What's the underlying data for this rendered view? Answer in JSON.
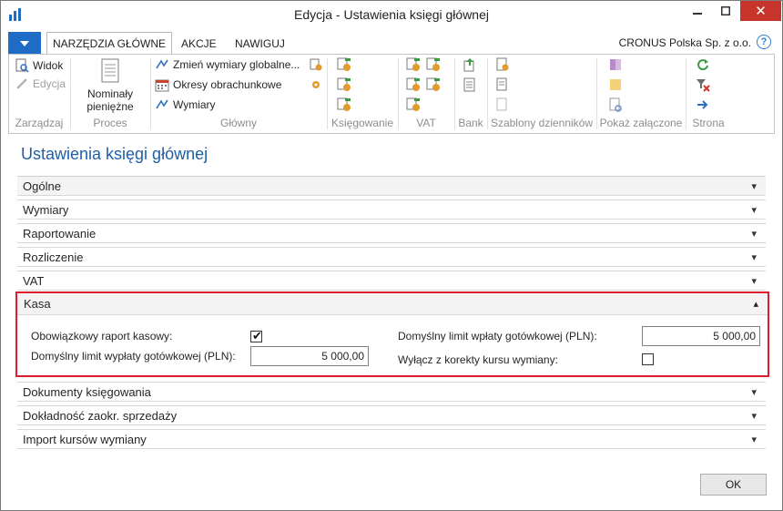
{
  "window": {
    "title": "Edycja - Ustawienia księgi głównej",
    "minimize_icon": "minimize-icon",
    "maximize_icon": "maximize-icon",
    "close_icon": "close-icon"
  },
  "menu": {
    "tabs": [
      {
        "label": "NARZĘDZIA GŁÓWNE",
        "active": true
      },
      {
        "label": "AKCJE",
        "active": false
      },
      {
        "label": "NAWIGUJ",
        "active": false
      }
    ],
    "company": "CRONUS Polska Sp. z o.o.",
    "help_glyph": "?"
  },
  "ribbon": {
    "groups": {
      "zarzadzaj": {
        "label": "Zarządzaj",
        "items": [
          {
            "label": "Widok",
            "icon": "view-icon",
            "disabled": false
          },
          {
            "label": "Edycja",
            "icon": "edit-icon",
            "disabled": true
          }
        ]
      },
      "proces": {
        "label": "Proces",
        "big_button": "Nominały pieniężne",
        "big_button_line1": "Nominały",
        "big_button_line2": "pieniężne"
      },
      "glowny": {
        "label": "Główny",
        "items": [
          {
            "label": "Zmień wymiary globalne...",
            "icon": "change-dimensions-icon"
          },
          {
            "label": "Okresy obrachunkowe",
            "icon": "calendar-icon"
          },
          {
            "label": "Wymiary",
            "icon": "dimensions-icon"
          }
        ]
      },
      "ksiegowanie": {
        "label": "Księgowanie"
      },
      "vat": {
        "label": "VAT"
      },
      "bank": {
        "label": "Bank"
      },
      "szablony": {
        "label": "Szablony dzienników"
      },
      "zalaczone": {
        "label": "Pokaż załączone"
      },
      "strona": {
        "label": "Strona"
      }
    }
  },
  "page": {
    "heading": "Ustawienia księgi głównej",
    "fasttabs_top": [
      "Ogólne",
      "Wymiary",
      "Raportowanie",
      "Rozliczenie",
      "VAT"
    ],
    "kasa": {
      "title": "Kasa",
      "fields": {
        "mandatory_report_label": "Obowiązkowy raport kasowy:",
        "mandatory_report_checked": true,
        "payout_limit_label": "Domyślny limit wypłaty gotówkowej (PLN):",
        "payout_limit_value": "5 000,00",
        "deposit_limit_label": "Domyślny limit wpłaty gotówkowej (PLN):",
        "deposit_limit_value": "5 000,00",
        "exclude_rate_label": "Wyłącz z korekty kursu wymiany:",
        "exclude_rate_checked": false
      }
    },
    "fasttabs_bottom": [
      "Dokumenty księgowania",
      "Dokładność zaokr. sprzedaży",
      "Import kursów wymiany"
    ]
  },
  "footer": {
    "ok_label": "OK"
  },
  "colors": {
    "accent": "#1f6cc6",
    "heading": "#1f5fa8",
    "highlight": "#dd1c2c",
    "close": "#c7342c"
  }
}
